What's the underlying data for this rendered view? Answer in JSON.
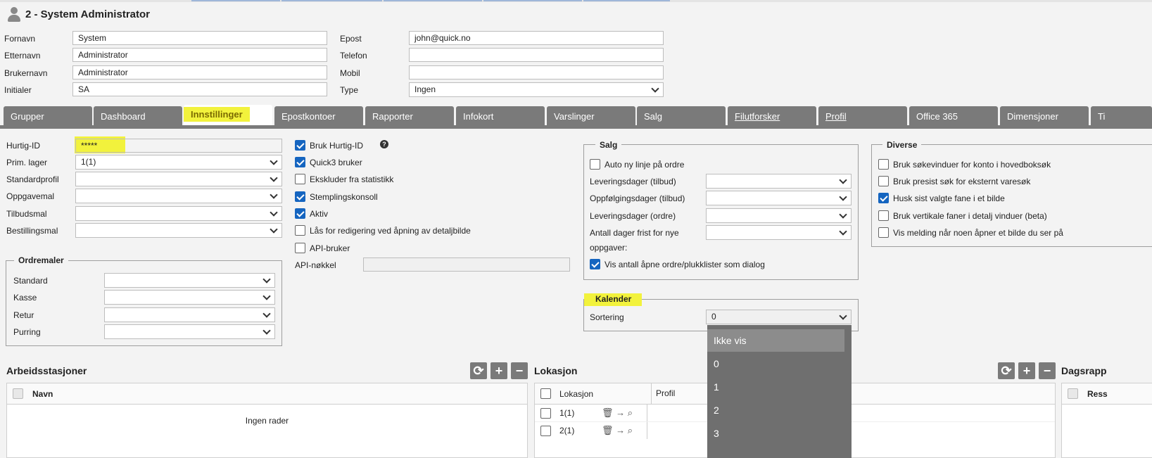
{
  "header": {
    "title": "2 - System Administrator"
  },
  "user_fields": {
    "fornavn_label": "Fornavn",
    "fornavn_value": "System",
    "etternavn_label": "Etternavn",
    "etternavn_value": "Administrator",
    "brukernavn_label": "Brukernavn",
    "brukernavn_value": "Administrator",
    "initialer_label": "Initialer",
    "initialer_value": "SA",
    "epost_label": "Epost",
    "epost_value": "john@quick.no",
    "telefon_label": "Telefon",
    "telefon_value": "",
    "mobil_label": "Mobil",
    "mobil_value": "",
    "type_label": "Type",
    "type_value": "Ingen"
  },
  "tabs": [
    "Grupper",
    "Dashboard",
    "Innstillinger",
    "Epostkontoer",
    "Rapporter",
    "Infokort",
    "Varslinger",
    "Salg",
    "Filutforsker",
    "Profil",
    "Office 365",
    "Dimensjoner",
    "Ti"
  ],
  "settings": {
    "hurtig_id_label": "Hurtig-ID",
    "hurtig_id_value": "*****",
    "prim_lager_label": "Prim. lager",
    "prim_lager_value": "1(1)",
    "standardprofil_label": "Standardprofil",
    "oppgavemal_label": "Oppgavemal",
    "tilbudsmal_label": "Tilbudsmal",
    "bestillingsmal_label": "Bestillingsmal"
  },
  "ordremaler": {
    "legend": "Ordremaler",
    "standard_label": "Standard",
    "kasse_label": "Kasse",
    "retur_label": "Retur",
    "purring_label": "Purring"
  },
  "checkboxes": {
    "bruk_hurtig_id": "Bruk Hurtig-ID",
    "quick3_bruker": "Quick3 bruker",
    "ekskluder": "Ekskluder fra statistikk",
    "stemplingskonsoll": "Stemplingskonsoll",
    "aktiv": "Aktiv",
    "laas": "Lås for redigering ved åpning av detaljbilde",
    "api_bruker": "API-bruker",
    "api_nokkel_label": "API-nøkkel"
  },
  "salg": {
    "legend": "Salg",
    "auto_ny_linje": "Auto ny linje på ordre",
    "leveringsdager_tilbud": "Leveringsdager (tilbud)",
    "oppfolgingsdager_tilbud": "Oppfølgingsdager (tilbud)",
    "leveringsdager_ordre": "Leveringsdager (ordre)",
    "antall_dager_line1": "Antall dager frist for nye",
    "antall_dager_line2": "oppgaver:",
    "vis_antall": "Vis antall åpne ordre/plukklister som dialog"
  },
  "diverse": {
    "legend": "Diverse",
    "items": [
      {
        "label": "Bruk søkevinduer for konto i hovedboksøk",
        "checked": false
      },
      {
        "label": "Bruk presist søk for eksternt varesøk",
        "checked": false
      },
      {
        "label": "Husk sist valgte fane i et bilde",
        "checked": true
      },
      {
        "label": "Bruk vertikale faner i detalj vinduer (beta)",
        "checked": false
      },
      {
        "label": "Vis melding når noen åpner et bilde du ser på",
        "checked": false
      }
    ]
  },
  "kalender": {
    "legend": "Kalender",
    "sortering_label": "Sortering",
    "sortering_value": "0",
    "options": [
      "Ikke vis",
      "0",
      "1",
      "2",
      "3"
    ]
  },
  "arbeidsstasjoner": {
    "title": "Arbeidsstasjoner",
    "col_navn": "Navn",
    "empty": "Ingen rader"
  },
  "lokasjon": {
    "title": "Lokasjon",
    "col_lokasjon": "Lokasjon",
    "col_profil": "Profil",
    "rows": [
      "1(1)",
      "2(1)"
    ]
  },
  "dagsrapport": {
    "title": "Dagsrapp",
    "col": "Ress"
  },
  "colors": {
    "highlight": "#f2f23c",
    "tab_bg": "#7a7a7a",
    "checkbox": "#1565c0"
  },
  "icons": [
    "user-icon",
    "refresh-icon",
    "plus-icon",
    "minus-icon",
    "trash-icon",
    "arrow-right-icon",
    "search-icon",
    "help-icon",
    "chevron-down-icon"
  ]
}
